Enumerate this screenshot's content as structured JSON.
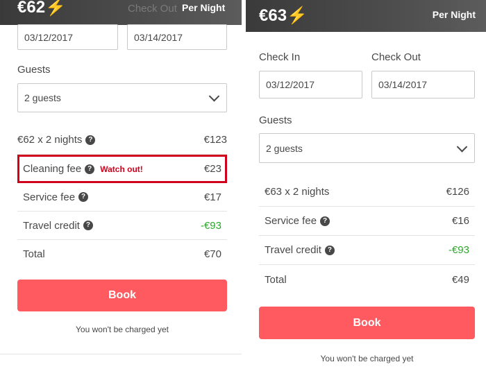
{
  "left": {
    "price": "€62",
    "per_night": "Per Night",
    "check_out_label": "Check Out",
    "check_in_value": "03/12/2017",
    "check_out_value": "03/14/2017",
    "guests_label": "Guests",
    "guests_value": "2 guests",
    "rows": [
      {
        "label": "€62 x 2 nights",
        "value": "€123"
      },
      {
        "label": "Cleaning fee",
        "value": "€23",
        "warning": "Watch out!"
      },
      {
        "label": "Service fee",
        "value": "€17"
      },
      {
        "label": "Travel credit",
        "value": "-€93"
      },
      {
        "label": "Total",
        "value": "€70"
      }
    ],
    "book_label": "Book",
    "note": "You won't be charged yet"
  },
  "right": {
    "price": "€63",
    "per_night": "Per Night",
    "check_in_label": "Check In",
    "check_out_label": "Check Out",
    "check_in_value": "03/12/2017",
    "check_out_value": "03/14/2017",
    "guests_label": "Guests",
    "guests_value": "2 guests",
    "rows": [
      {
        "label": "€63 x 2 nights",
        "value": "€126"
      },
      {
        "label": "Service fee",
        "value": "€16"
      },
      {
        "label": "Travel credit",
        "value": "-€93"
      },
      {
        "label": "Total",
        "value": "€49"
      }
    ],
    "book_label": "Book",
    "note": "You won't be charged yet"
  },
  "icons": {
    "bolt": "lightning-bolt-icon",
    "help": "question-circle-icon",
    "chevron": "chevron-down-icon"
  },
  "colors": {
    "accent": "#ff5a5f",
    "bolt": "#ffb400",
    "credit": "#2aa82a",
    "warning": "#d0021b"
  }
}
